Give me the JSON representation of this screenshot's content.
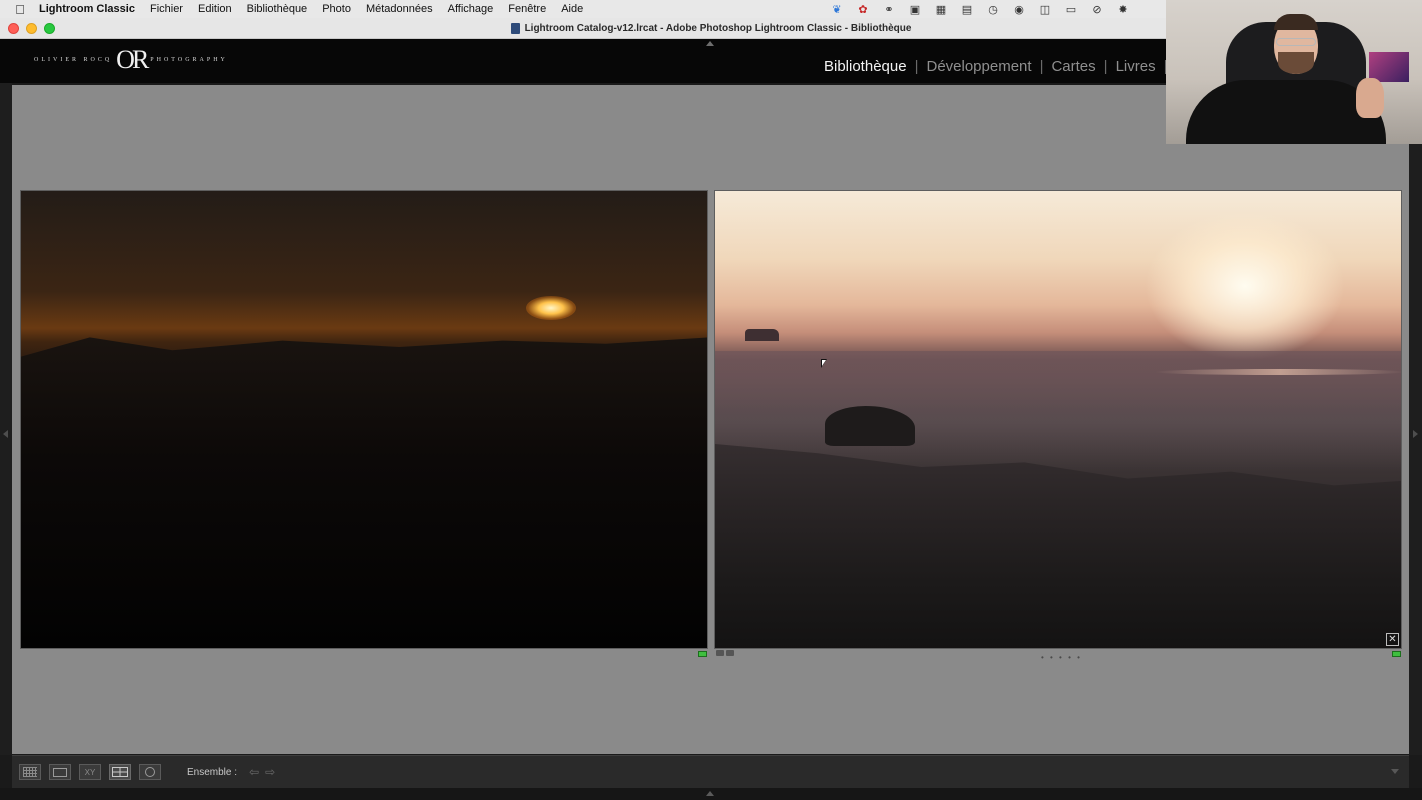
{
  "menubar": {
    "app_name": "Lightroom Classic",
    "items": [
      "Fichier",
      "Edition",
      "Bibliothèque",
      "Photo",
      "Métadonnées",
      "Affichage",
      "Fenêtre",
      "Aide"
    ]
  },
  "window": {
    "title": "Lightroom Catalog-v12.lrcat - Adobe Photoshop Lightroom Classic - Bibliothèque"
  },
  "identity_plate": {
    "left_text": "OLIVIER ROCQ",
    "mark": "OR",
    "right_text": "PHOTOGRAPHY"
  },
  "modules": {
    "items": [
      "Bibliothèque",
      "Développement",
      "Cartes",
      "Livres"
    ],
    "active": "Bibliothèque"
  },
  "toolbar": {
    "ensemble_label": "Ensemble :",
    "view_mode": "survey"
  },
  "colors": {
    "panel_gray": "#8a8a8a",
    "pick_green": "#3fbf3f",
    "toolbar_dark": "#2a2a2a"
  },
  "icons": {
    "menubar_status": [
      "bird-icon",
      "butterfly-icon",
      "creative-cloud-icon",
      "camera-icon",
      "screen-icon",
      "clipboard-icon",
      "clock-icon",
      "binoculars-icon",
      "split-icon",
      "display-icon",
      "wifi-off-icon",
      "fan-icon"
    ]
  }
}
